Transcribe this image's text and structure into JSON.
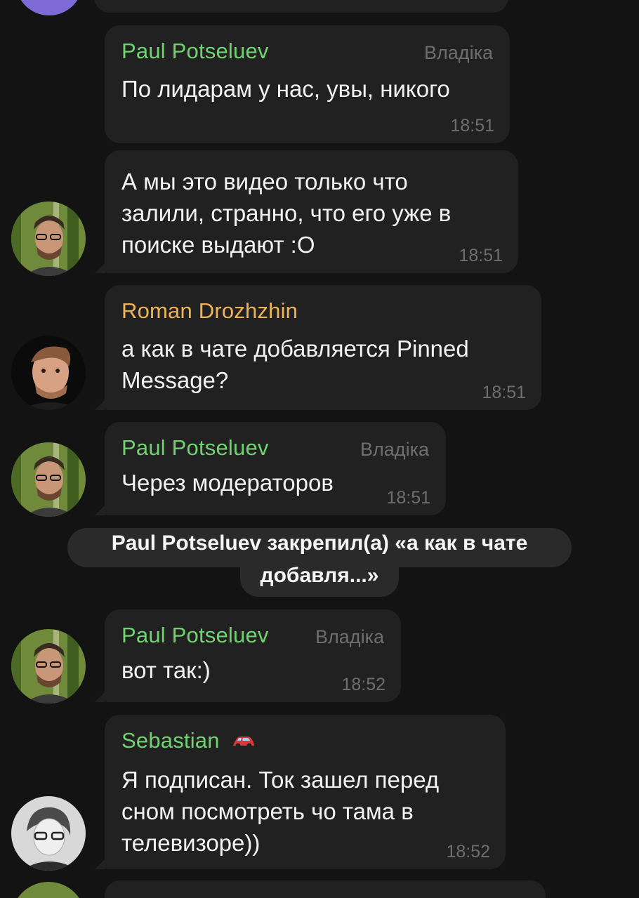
{
  "colors": {
    "background": "#131313",
    "bubble": "#212121",
    "sender_green": "#6fd46f",
    "sender_orange": "#f0b354",
    "meta_gray": "#6e6e6e",
    "service_bg": "#2a2a2a"
  },
  "messages": [
    {
      "sender": "Paul Potseluev",
      "role": "Владіка",
      "text": "По лидарам у нас, увы, никого",
      "time": "18:51"
    },
    {
      "text": "А мы это видео только что\nзалили, странно, что его уже в\nпоиске выдают :О",
      "time": "18:51"
    },
    {
      "sender": "Roman Drozhzhin",
      "text": "а как в чате добавляется Pinned\nMessage?",
      "time": "18:51"
    },
    {
      "sender": "Paul Potseluev",
      "role": "Владіка",
      "text": "Через модераторов",
      "time": "18:51"
    },
    {
      "sender": "Paul Potseluev",
      "role": "Владіка",
      "text": "вот так:)",
      "time": "18:52"
    },
    {
      "sender": "Sebastian",
      "text": "Я подписан. Ток зашел перед\nсном посмотреть чо тама в\nтелевизоре))",
      "time": "18:52"
    }
  ],
  "service_message": {
    "line1": "Paul Potseluev закрепил(а) «а как в чате",
    "line2": "добавля...»"
  },
  "icons": {
    "sebastian_badge": "car-icon"
  }
}
